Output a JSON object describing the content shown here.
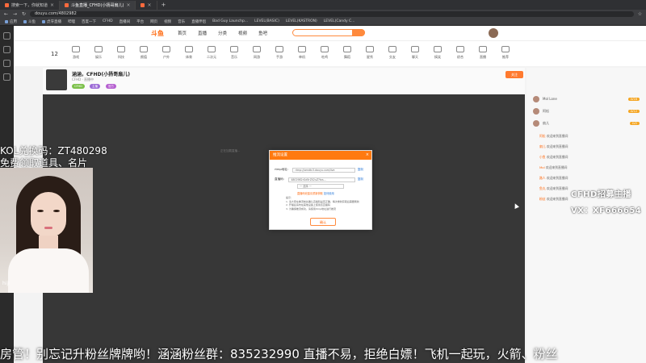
{
  "browser": {
    "tabs": [
      {
        "label": "搜索一下，你就知道",
        "active": false
      },
      {
        "label": "斗鱼直播_CFHD(小扬哥扇儿)",
        "active": true
      },
      {
        "label": "",
        "active": false
      }
    ],
    "url": "douyu.com/4802982",
    "bookmarks": [
      "应用",
      "斗鱼",
      "虎牙直播",
      "哔哩",
      "百度一下",
      "CFHD",
      "直播间",
      "平台",
      "网页",
      "视频",
      "音乐",
      "直播伴侣",
      "Bad Guy Launchp...",
      "LEVEL(BASIC)",
      "LEVEL(KASTRON)",
      "LEVEL(Candy C..."
    ]
  },
  "site": {
    "logo": "斗鱼",
    "nav": [
      "首页",
      "直播",
      "分类",
      "视频",
      "鱼吧"
    ],
    "level": "12",
    "categories": [
      "游戏",
      "娱乐",
      "科技",
      "颜值",
      "户外",
      "体育",
      "二次元",
      "音乐",
      "网游",
      "手游",
      "单机",
      "吃鸡",
      "舞蹈",
      "星秀",
      "交友",
      "聊天",
      "搞笑",
      "综合",
      "直播",
      "推荐"
    ]
  },
  "room": {
    "title": "涵涵，CFHD(小扬哥扇儿)",
    "subtitle": "CFHD · 直播中",
    "tags": [
      "CFHD",
      "主播",
      "官方"
    ],
    "follow_label": "关注",
    "player_hint": "正在加载直播..."
  },
  "right_panel": {
    "fans": [
      {
        "name": "Mol Lone",
        "badge": "LV16"
      },
      {
        "name": "阿松",
        "badge": "LV12"
      },
      {
        "name": "扇儿",
        "badge": "LV2"
      }
    ],
    "messages": [
      {
        "user": "阿松",
        "text": "欢迎来到直播间"
      },
      {
        "user": "扇儿",
        "text": "欢迎来到直播间"
      },
      {
        "user": "小鱼",
        "text": "欢迎来到直播间"
      },
      {
        "user": "Mol",
        "text": "欢迎来到直播间"
      },
      {
        "user": "路人",
        "text": "欢迎来到直播间"
      },
      {
        "user": "鱼丸",
        "text": "欢迎来到直播间"
      },
      {
        "user": "粉丝",
        "text": "欢迎来到直播间"
      }
    ]
  },
  "dialog": {
    "title": "推流设置",
    "rtmp_label": "rtmp地址：",
    "rtmp_value": "rtmp://sendtc3.douyu.com/live",
    "copy_label": "复制",
    "code_label": "直播码：",
    "code_value": "4802982rGd5rZ02uZ?txs...",
    "select_value": "一 选择 一",
    "warn_link": "直播码泄露请重新获取",
    "help_link": "如何使用",
    "tips": [
      "提示：",
      "1. 请大家在推流前先确认直播码是否正确，每次重新获取后需要刷新",
      "2. 开播后请勿在其他设备上使用该直播码",
      "3. 为确保推流成功，请使用rtmp地址进行推流"
    ],
    "confirm_label": "确认"
  },
  "overlay": {
    "kol_line1": "KOL兑换码：ZT480298",
    "kol_line2": "免费领取道具、名片",
    "cam_tag": "hiji",
    "recruit_line1": "CFHD招募主播",
    "recruit_line2": "VX：XF666654",
    "marquee": "房管！别忘记升粉丝牌牌哟！涵涵粉丝群：835232990 直播不易，拒绝白嫖！飞机一起玩，火箭、粉丝"
  },
  "colors": {
    "accent": "#ff7a10",
    "link": "#2d7bd8"
  }
}
